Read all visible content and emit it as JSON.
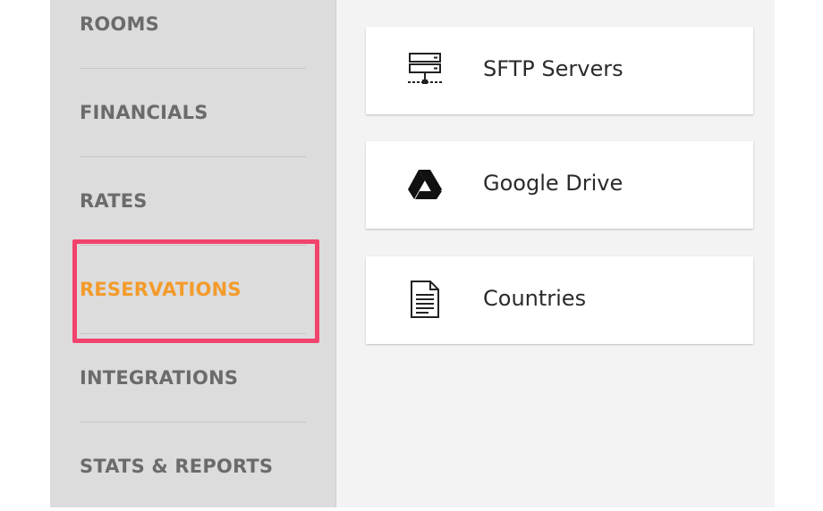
{
  "sidebar": {
    "items": [
      {
        "label": "ROOMS",
        "active": false
      },
      {
        "label": "FINANCIALS",
        "active": false
      },
      {
        "label": "RATES",
        "active": false
      },
      {
        "label": "RESERVATIONS",
        "active": true
      },
      {
        "label": "INTEGRATIONS",
        "active": false
      },
      {
        "label": "STATS & REPORTS",
        "active": false
      }
    ]
  },
  "cards": [
    {
      "label": "SFTP Servers",
      "icon": "server-icon"
    },
    {
      "label": "Google Drive",
      "icon": "google-drive-icon"
    },
    {
      "label": "Countries",
      "icon": "document-icon"
    }
  ],
  "colors": {
    "active": "#f39b2a",
    "highlight": "#f2436d",
    "nav_text": "#6b6b6b",
    "sidebar_bg": "#dcdcdc",
    "content_bg": "#f3f3f3"
  }
}
